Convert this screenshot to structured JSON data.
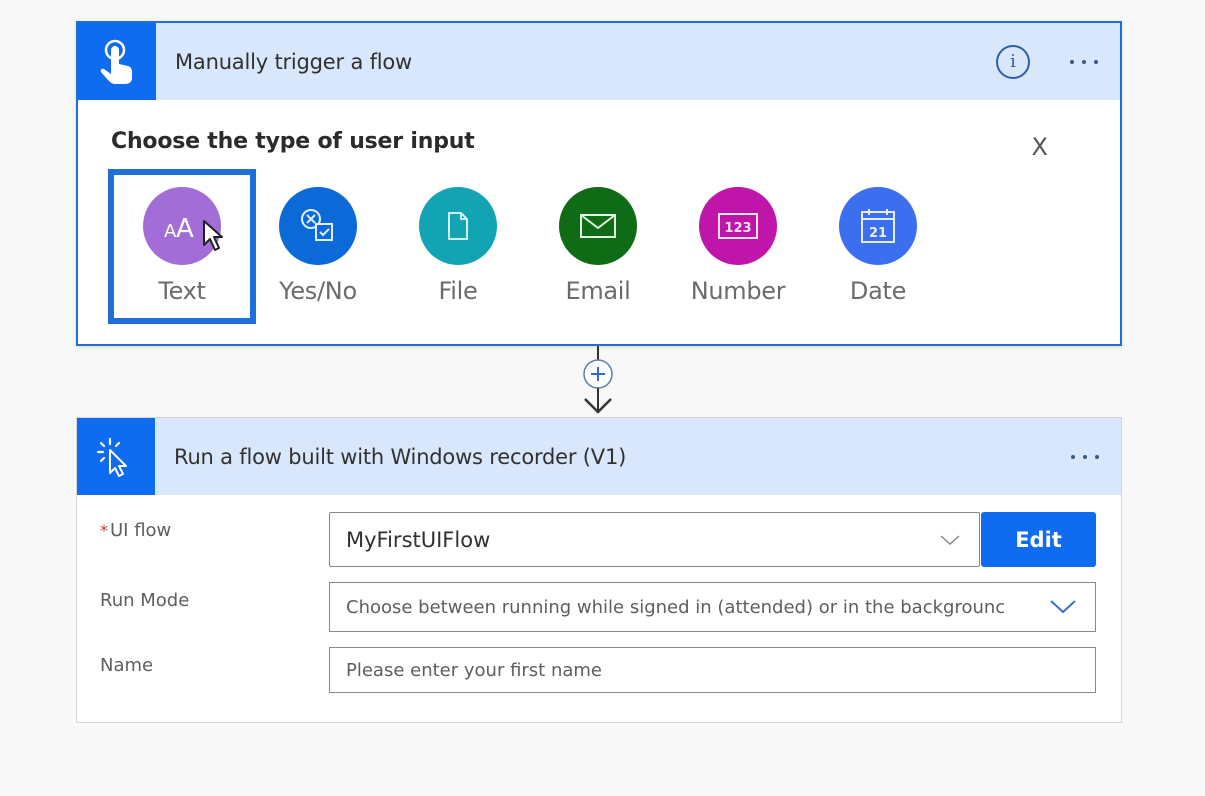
{
  "trigger_card": {
    "icon": "touch-hand-icon",
    "title": "Manually trigger a flow",
    "info_icon": "info-icon",
    "info_glyph": "i",
    "more_icon": "more-ellipsis-icon",
    "prompt": "Choose the type of user input",
    "close_label": "X",
    "input_types": [
      {
        "label": "Text",
        "icon": "text-aa-icon",
        "color": "#a26dd6",
        "selected": true
      },
      {
        "label": "Yes/No",
        "icon": "yes-no-icon",
        "color": "#0c6ad8",
        "selected": false
      },
      {
        "label": "File",
        "icon": "file-icon",
        "color": "#12a4b2",
        "selected": false
      },
      {
        "label": "Email",
        "icon": "email-icon",
        "color": "#0f6b16",
        "selected": false
      },
      {
        "label": "Number",
        "icon": "number-icon",
        "color": "#bf15a8",
        "selected": false
      },
      {
        "label": "Date",
        "icon": "calendar-icon",
        "color": "#3c6ef0",
        "selected": false
      }
    ],
    "number_glyph": "123",
    "date_glyph": "21",
    "text_glyph": "AA"
  },
  "connector": {
    "add_icon": "plus-circle-icon",
    "arrow_icon": "arrow-down-icon"
  },
  "action_card": {
    "icon": "cursor-click-icon",
    "title": "Run a flow built with Windows recorder (V1)",
    "more_icon": "more-ellipsis-icon",
    "fields": {
      "ui_flow": {
        "required_mark": "*",
        "label": "UI flow",
        "value": "MyFirstUIFlow",
        "edit_label": "Edit"
      },
      "run_mode": {
        "label": "Run Mode",
        "placeholder": "Choose between running while signed in (attended) or in the backgrounc"
      },
      "name": {
        "label": "Name",
        "placeholder": "Please enter your first name"
      }
    }
  },
  "colors": {
    "accent": "#0f6cf0",
    "header_bg": "#d8e7fc",
    "selection_border": "#1f6fd8"
  }
}
